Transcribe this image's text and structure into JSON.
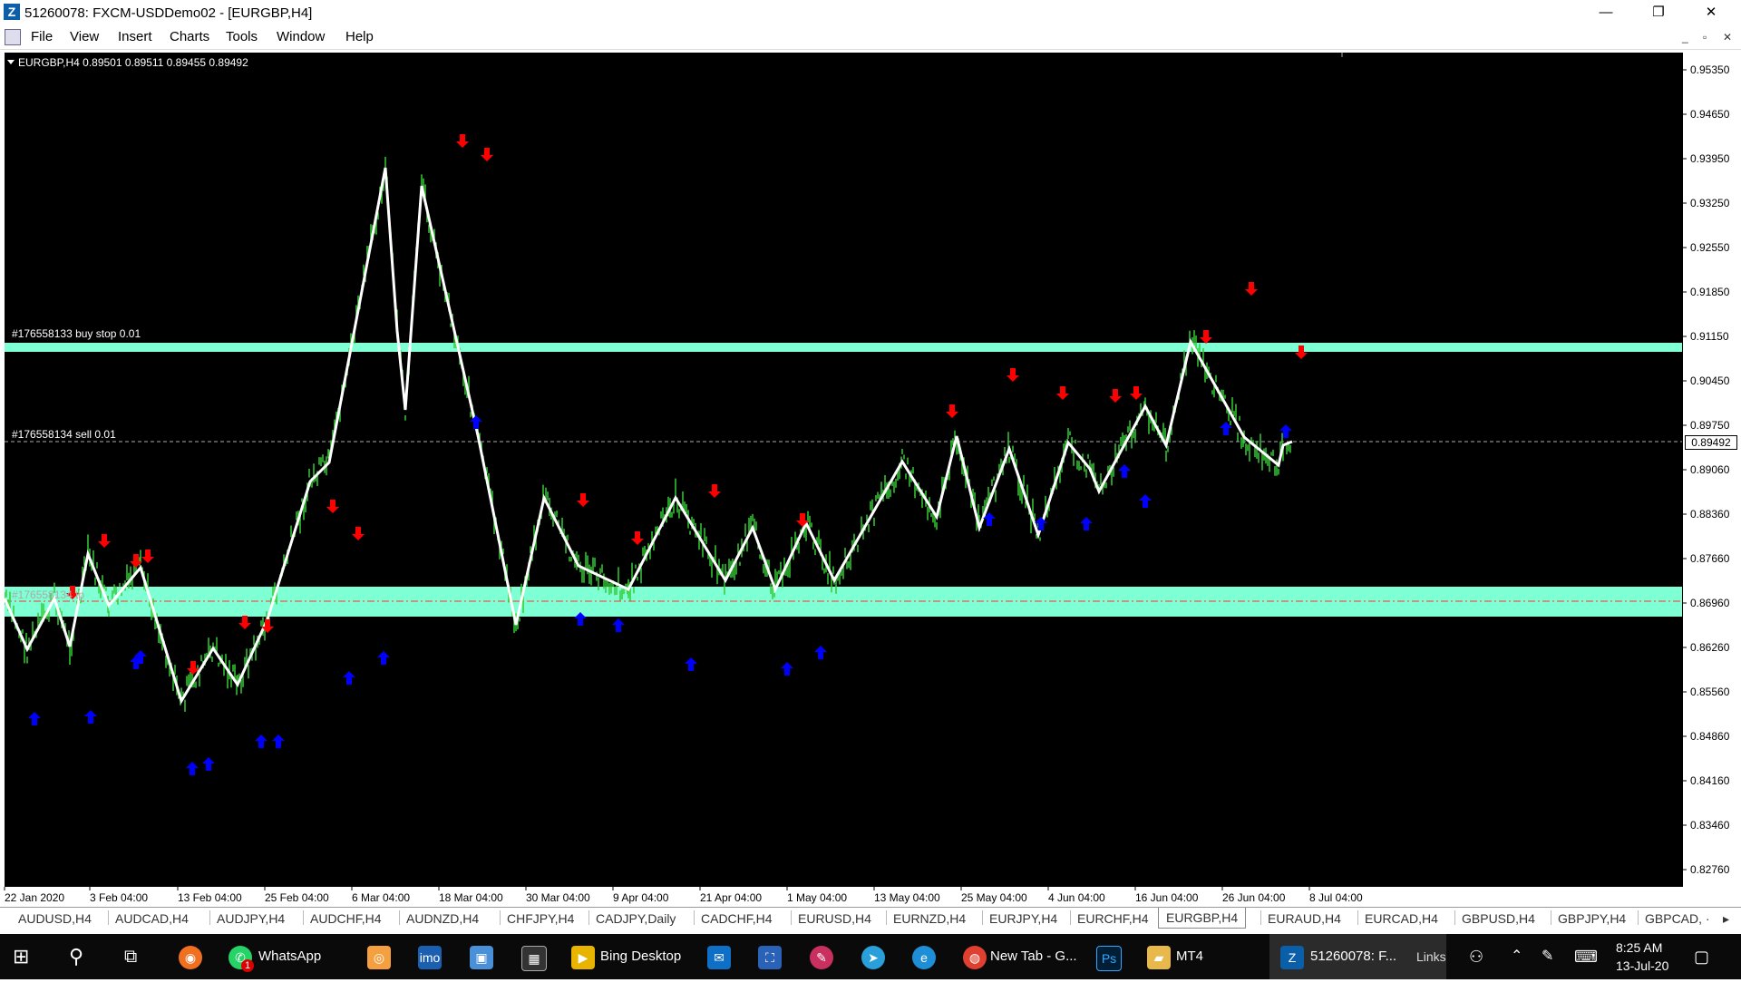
{
  "window": {
    "title": "51260078: FXCM-USDDemo02 - [EURGBP,H4]",
    "icon": "mt4-icon",
    "controls": {
      "minimize": "—",
      "restore": "❐",
      "close": "✕"
    }
  },
  "menu": {
    "items": [
      "File",
      "View",
      "Insert",
      "Charts",
      "Tools",
      "Window",
      "Help"
    ]
  },
  "chart": {
    "header": "EURGBP,H4  0.89501 0.89511 0.89455 0.89492",
    "order_buy_stop": "#176558133 buy stop 0.01",
    "order_sell": "#176558134 sell 0.01",
    "order_tp": "#176558134 tp",
    "current_price": "0.89492",
    "colors": {
      "background": "#000000",
      "candles": "#33cc33",
      "zigzag": "#ffffff",
      "arrow_down": "#ff0000",
      "arrow_up": "#0000ff",
      "band": "#7fffd4"
    }
  },
  "price_axis": {
    "labels": [
      "0.95350",
      "0.94650",
      "0.93950",
      "0.93250",
      "0.92550",
      "0.91850",
      "0.91150",
      "0.90450",
      "0.89750",
      "0.89060",
      "0.88360",
      "0.87660",
      "0.86960",
      "0.86260",
      "0.85560",
      "0.84860",
      "0.84160",
      "0.83460",
      "0.82760"
    ]
  },
  "time_axis": {
    "labels": [
      "22 Jan 2020",
      "3 Feb 04:00",
      "13 Feb 04:00",
      "25 Feb 04:00",
      "6 Mar 04:00",
      "18 Mar 04:00",
      "30 Mar 04:00",
      "9 Apr 04:00",
      "21 Apr 04:00",
      "1 May 04:00",
      "13 May 04:00",
      "25 May 04:00",
      "4 Jun 04:00",
      "16 Jun 04:00",
      "26 Jun 04:00",
      "8 Jul 04:00"
    ]
  },
  "tabs": {
    "items": [
      "AUDUSD,H4",
      "AUDCAD,H4",
      "AUDJPY,H4",
      "AUDCHF,H4",
      "AUDNZD,H4",
      "CHFJPY,H4",
      "CADJPY,Daily",
      "CADCHF,H4",
      "EURUSD,H4",
      "EURNZD,H4",
      "EURJPY,H4",
      "EURCHF,H4",
      "EURGBP,H4",
      "EURAUD,H4",
      "EURCAD,H4",
      "GBPUSD,H4",
      "GBPJPY,H4",
      "GBPCAD, ·"
    ],
    "active": "EURGBP,H4"
  },
  "taskbar": {
    "whatsapp": "WhatsApp",
    "whatsapp_badge": "1",
    "bing": "Bing Desktop",
    "chrome": "New Tab - G...",
    "mt4_folder": "MT4",
    "mt4_window": "51260078: F...",
    "links": "Links",
    "time": "8:25 AM",
    "date": "13-Jul-20"
  }
}
